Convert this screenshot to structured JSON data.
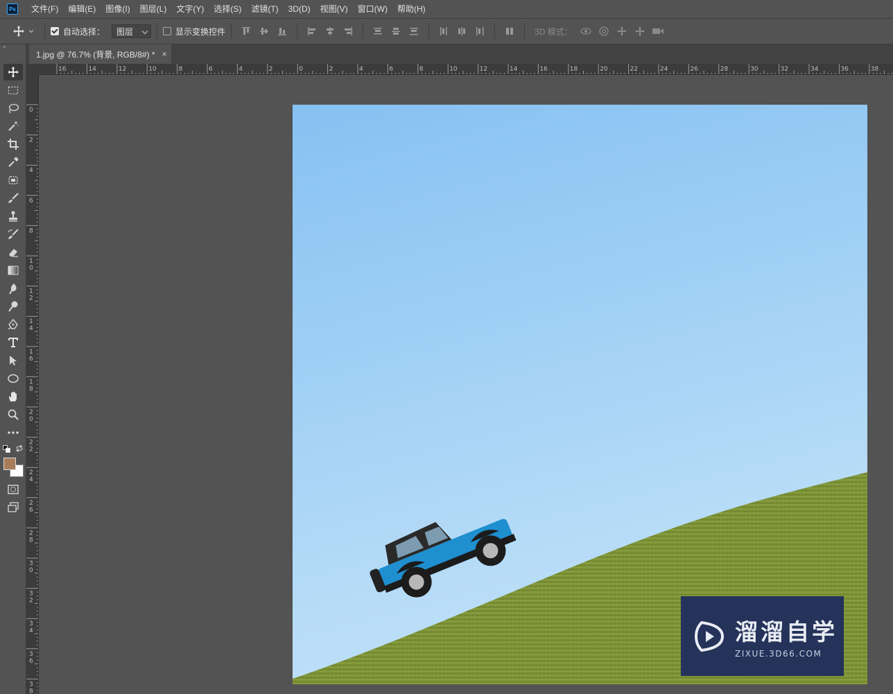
{
  "app": {
    "logo": "Ps"
  },
  "menu": [
    "文件(F)",
    "编辑(E)",
    "图像(I)",
    "图层(L)",
    "文字(Y)",
    "选择(S)",
    "滤镜(T)",
    "3D(D)",
    "视图(V)",
    "窗口(W)",
    "帮助(H)"
  ],
  "options": {
    "auto_select_label": "自动选择：",
    "auto_select_checked": true,
    "auto_select_target": "图层",
    "show_transform_label": "显示变换控件",
    "show_transform_checked": false,
    "mode_3d_label": "3D 模式："
  },
  "document": {
    "tab_title": "1.jpg @ 76.7% (背景, RGB/8#) *",
    "close_glyph": "×"
  },
  "rulers": {
    "horizontal": [
      "16",
      "14",
      "12",
      "10",
      "8",
      "6",
      "4",
      "2",
      "0",
      "2",
      "4",
      "6",
      "8",
      "10",
      "12",
      "14",
      "16",
      "18",
      "20",
      "22",
      "24",
      "26",
      "28",
      "30",
      "32",
      "34",
      "36",
      "38"
    ],
    "vertical": [
      "0",
      "2",
      "4",
      "6",
      "8",
      "10",
      "12",
      "14",
      "16",
      "18",
      "20",
      "22",
      "24",
      "26",
      "28",
      "30",
      "32",
      "34",
      "36",
      "38"
    ]
  },
  "colors": {
    "foreground": "#a97c5a",
    "background": "#ffffff",
    "sky_top": "#86c1f2",
    "sky_bottom": "#bfe0f8",
    "grass": "#7f9638",
    "jeep": "#1f8fd0"
  },
  "watermark": {
    "title": "溜溜自学",
    "url": "ZIXUE.3D66.COM"
  }
}
